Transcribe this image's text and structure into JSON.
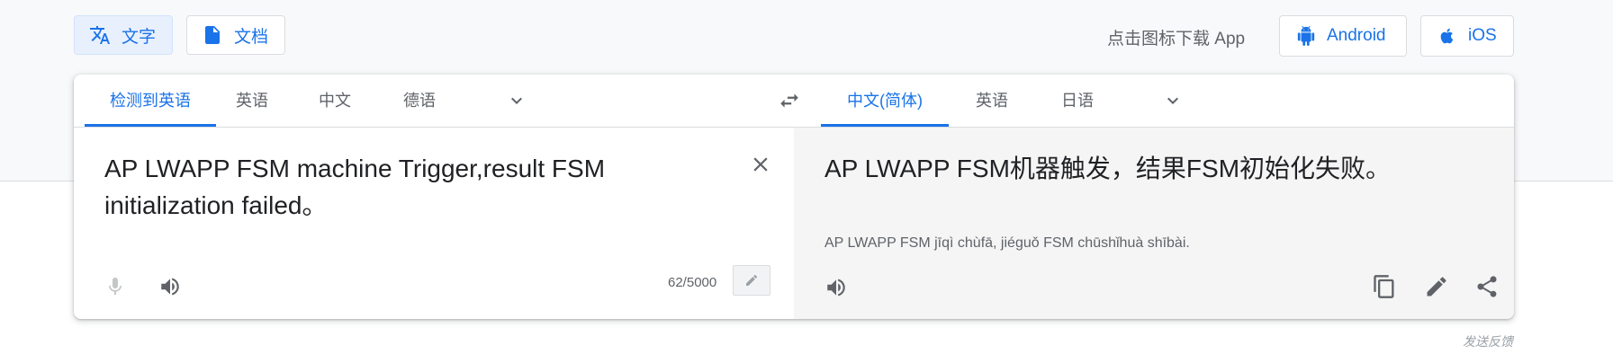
{
  "modes": {
    "text_label": "文字",
    "document_label": "文档"
  },
  "download": {
    "prompt": "点击图标下载 App",
    "android_label": "Android",
    "ios_label": "iOS"
  },
  "source_langs": [
    "检测到英语",
    "英语",
    "中文",
    "德语"
  ],
  "target_langs": [
    "中文(简体)",
    "英语",
    "日语"
  ],
  "source": {
    "text": "AP LWAPP FSM machine Trigger,result FSM initialization failed。",
    "char_count": "62/5000"
  },
  "target": {
    "text": "AP LWAPP FSM机器触发，结果FSM初始化失败。",
    "pinyin": "AP LWAPP FSM jīqì chùfā, jiéguǒ FSM chūshǐhuà shībài."
  },
  "feedback_label": "发送反馈",
  "colors": {
    "accent": "#1a73e8",
    "icon_gray": "#5f6368",
    "disabled_gray": "#c4c7c5",
    "target_bg": "#f5f5f5",
    "top_band": "#f8f9fa"
  }
}
